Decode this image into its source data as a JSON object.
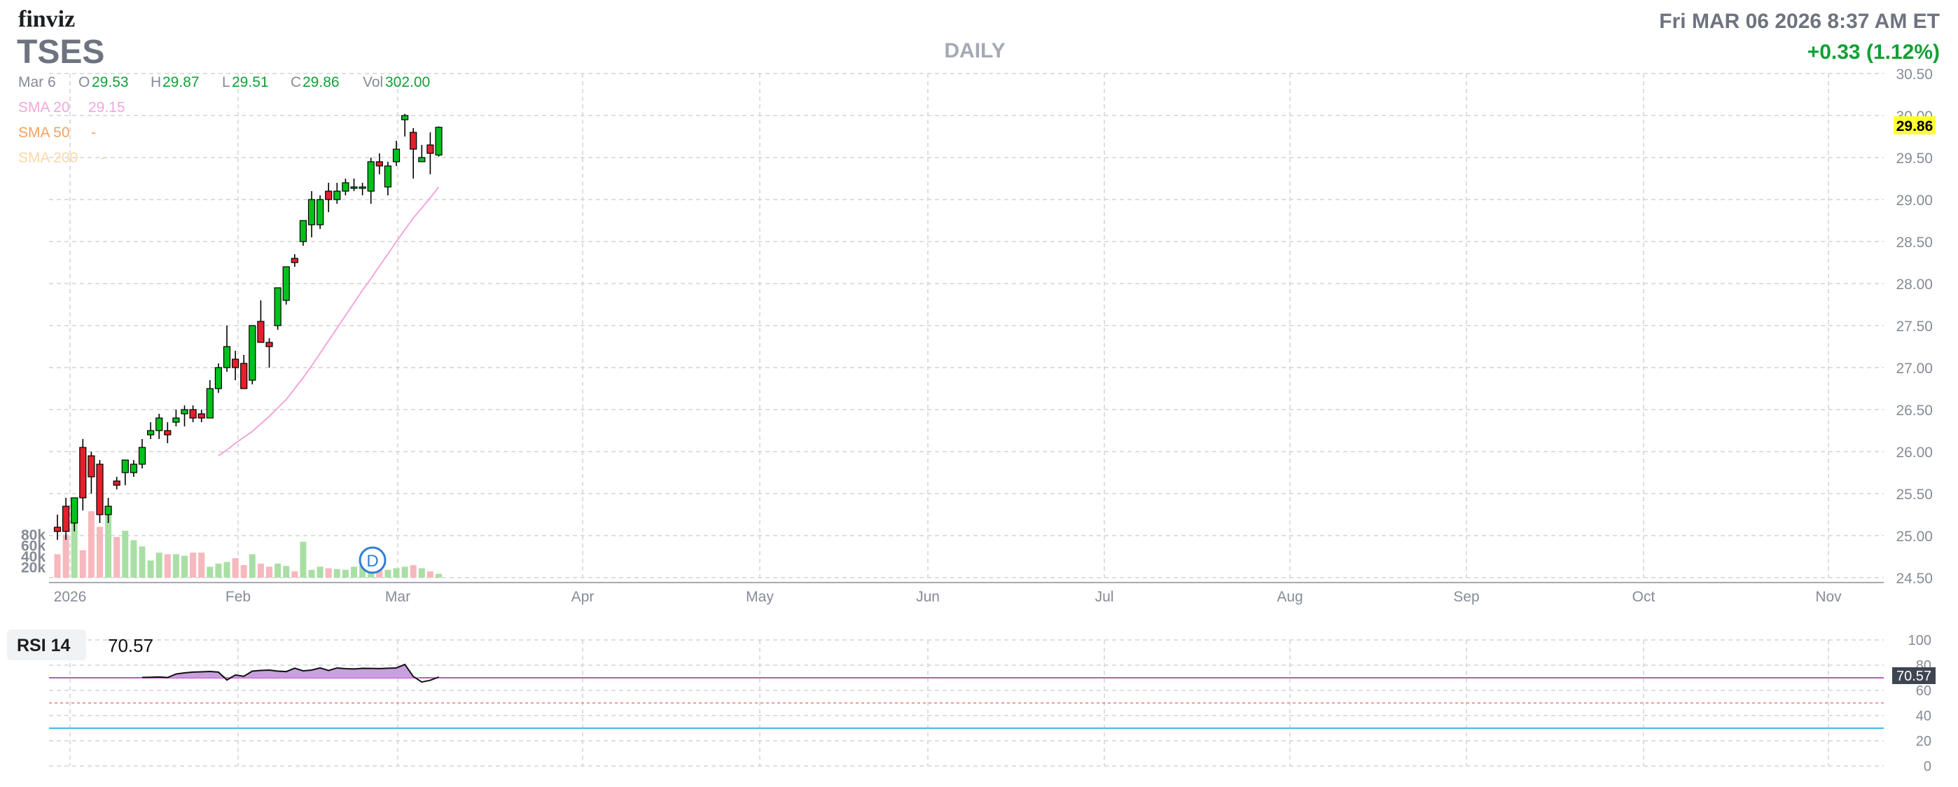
{
  "header": {
    "logo": "finviz",
    "ticker": "TSES",
    "timeframe": "DAILY",
    "datetime": "Fri MAR 06 2026 8:37 AM ET",
    "change": "+0.33 (1.12%)"
  },
  "quote": {
    "date": "Mar 6",
    "o_label": "O",
    "o": "29.53",
    "h_label": "H",
    "h": "29.87",
    "l_label": "L",
    "l": "29.51",
    "c_label": "C",
    "c": "29.86",
    "vol_label": "Vol",
    "vol": "302.00"
  },
  "sma": [
    {
      "label": "SMA 20",
      "value": "29.15",
      "color": "#f3a6dc"
    },
    {
      "label": "SMA 50",
      "value": "-",
      "color": "#f5a25d"
    },
    {
      "label": "SMA 200",
      "value": "-",
      "color": "#fbd9a5"
    }
  ],
  "rsi": {
    "label": "RSI 14",
    "value": "70.57",
    "badge": "70.57",
    "ylim": [
      0,
      100
    ],
    "overbought": 70,
    "oversold": 30,
    "midline": 50,
    "ticks": [
      "100",
      "80",
      "60",
      "40",
      "20",
      "0"
    ]
  },
  "last_price_badge": "29.86",
  "dividend_marker": "D",
  "colors": {
    "up": "#00c21c",
    "down": "#e3202c",
    "vol_up": "#a9dfa4",
    "vol_down": "#f7b7bd",
    "sma20": "#f3a6dc",
    "rsi_line": "#b259c8",
    "oversold_line": "#46b8e0",
    "price_badge": "#ffff33",
    "green_text": "#11a035",
    "grey_text": "#868b96"
  },
  "chart_data": {
    "type": "candlestick",
    "title": "TSES",
    "ylim": [
      24.5,
      30.5
    ],
    "yticks": [
      "30.50",
      "30.00",
      "29.50",
      "29.00",
      "28.50",
      "28.00",
      "27.50",
      "27.00",
      "26.50",
      "26.00",
      "25.50",
      "25.00",
      "24.50"
    ],
    "xticks": [
      "2026",
      "Feb",
      "Mar",
      "Apr",
      "May",
      "Jun",
      "Jul",
      "Aug",
      "Sep",
      "Oct",
      "Nov"
    ],
    "volume_ticks": [
      "80k",
      "60k",
      "40k",
      "20k"
    ],
    "volume_ylim": [
      0,
      100000
    ],
    "candles": [
      {
        "o": 25.1,
        "h": 25.25,
        "l": 24.95,
        "c": 25.05
      },
      {
        "o": 25.35,
        "h": 25.45,
        "l": 24.95,
        "c": 25.05
      },
      {
        "o": 25.15,
        "h": 25.45,
        "l": 25.05,
        "c": 25.45
      },
      {
        "o": 26.05,
        "h": 26.15,
        "l": 25.3,
        "c": 25.45
      },
      {
        "o": 25.95,
        "h": 26.0,
        "l": 25.5,
        "c": 25.7
      },
      {
        "o": 25.85,
        "h": 25.9,
        "l": 25.15,
        "c": 25.25
      },
      {
        "o": 25.25,
        "h": 25.45,
        "l": 25.15,
        "c": 25.35
      },
      {
        "o": 25.65,
        "h": 25.7,
        "l": 25.55,
        "c": 25.6
      },
      {
        "o": 25.75,
        "h": 25.85,
        "l": 25.6,
        "c": 25.9
      },
      {
        "o": 25.75,
        "h": 25.9,
        "l": 25.7,
        "c": 25.85
      },
      {
        "o": 25.85,
        "h": 26.15,
        "l": 25.8,
        "c": 26.05
      },
      {
        "o": 26.2,
        "h": 26.35,
        "l": 26.15,
        "c": 26.25
      },
      {
        "o": 26.25,
        "h": 26.45,
        "l": 26.15,
        "c": 26.4
      },
      {
        "o": 26.25,
        "h": 26.35,
        "l": 26.1,
        "c": 26.2
      },
      {
        "o": 26.35,
        "h": 26.5,
        "l": 26.3,
        "c": 26.4
      },
      {
        "o": 26.45,
        "h": 26.55,
        "l": 26.3,
        "c": 26.5
      },
      {
        "o": 26.5,
        "h": 26.55,
        "l": 26.35,
        "c": 26.4
      },
      {
        "o": 26.45,
        "h": 26.5,
        "l": 26.35,
        "c": 26.4
      },
      {
        "o": 26.4,
        "h": 26.85,
        "l": 26.4,
        "c": 26.75
      },
      {
        "o": 26.75,
        "h": 27.05,
        "l": 26.7,
        "c": 27.0
      },
      {
        "o": 27.0,
        "h": 27.5,
        "l": 26.95,
        "c": 27.25
      },
      {
        "o": 27.1,
        "h": 27.2,
        "l": 26.85,
        "c": 27.0
      },
      {
        "o": 27.05,
        "h": 27.15,
        "l": 26.75,
        "c": 26.75
      },
      {
        "o": 26.85,
        "h": 27.5,
        "l": 26.8,
        "c": 27.5
      },
      {
        "o": 27.55,
        "h": 27.8,
        "l": 27.4,
        "c": 27.3
      },
      {
        "o": 27.3,
        "h": 27.35,
        "l": 27.0,
        "c": 27.25
      },
      {
        "o": 27.5,
        "h": 27.95,
        "l": 27.45,
        "c": 27.95
      },
      {
        "o": 27.8,
        "h": 28.2,
        "l": 27.75,
        "c": 28.2
      },
      {
        "o": 28.3,
        "h": 28.35,
        "l": 28.2,
        "c": 28.25
      },
      {
        "o": 28.5,
        "h": 28.7,
        "l": 28.45,
        "c": 28.75
      },
      {
        "o": 28.7,
        "h": 29.1,
        "l": 28.55,
        "c": 29.0
      },
      {
        "o": 28.7,
        "h": 29.05,
        "l": 28.65,
        "c": 29.0
      },
      {
        "o": 29.1,
        "h": 29.2,
        "l": 28.85,
        "c": 29.0
      },
      {
        "o": 29.0,
        "h": 29.2,
        "l": 28.95,
        "c": 29.1
      },
      {
        "o": 29.1,
        "h": 29.25,
        "l": 29.05,
        "c": 29.2
      },
      {
        "o": 29.15,
        "h": 29.25,
        "l": 29.1,
        "c": 29.15
      },
      {
        "o": 29.15,
        "h": 29.2,
        "l": 29.05,
        "c": 29.15
      },
      {
        "o": 29.1,
        "h": 29.5,
        "l": 28.95,
        "c": 29.45
      },
      {
        "o": 29.45,
        "h": 29.55,
        "l": 29.3,
        "c": 29.4
      },
      {
        "o": 29.15,
        "h": 29.45,
        "l": 29.05,
        "c": 29.4
      },
      {
        "o": 29.45,
        "h": 29.7,
        "l": 29.4,
        "c": 29.6
      },
      {
        "o": 29.95,
        "h": 30.02,
        "l": 29.75,
        "c": 30.0
      },
      {
        "o": 29.8,
        "h": 29.85,
        "l": 29.25,
        "c": 29.6
      },
      {
        "o": 29.45,
        "h": 29.65,
        "l": 29.45,
        "c": 29.5
      },
      {
        "o": 29.65,
        "h": 29.8,
        "l": 29.3,
        "c": 29.55
      },
      {
        "o": 29.53,
        "h": 29.87,
        "l": 29.51,
        "c": 29.86
      }
    ],
    "volume": [
      30000,
      55000,
      72000,
      35000,
      85000,
      65000,
      90000,
      52000,
      60000,
      48000,
      40000,
      22000,
      32000,
      30000,
      30000,
      28000,
      32000,
      32000,
      14000,
      18000,
      20000,
      25000,
      16000,
      30000,
      18000,
      14000,
      18000,
      15000,
      8000,
      46000,
      10000,
      14000,
      12000,
      11000,
      10000,
      14000,
      16000,
      13000,
      10000,
      10000,
      12000,
      14000,
      16000,
      12000,
      8000,
      5000
    ],
    "sma20": [
      25.95,
      26.02,
      26.1,
      26.17,
      26.24,
      26.33,
      26.42,
      26.52,
      26.62,
      26.75,
      26.88,
      27.02,
      27.17,
      27.32,
      27.47,
      27.62,
      27.77,
      27.92,
      28.06,
      28.21,
      28.35,
      28.5,
      28.64,
      28.78,
      28.9,
      29.02,
      29.15
    ],
    "rsi": [
      70.3,
      70.4,
      70.6,
      70.2,
      73.0,
      73.9,
      74.5,
      74.7,
      75.0,
      74.5,
      68.2,
      72.2,
      71.2,
      75.3,
      75.8,
      76.1,
      75.3,
      74.9,
      77.6,
      75.5,
      76.1,
      77.8,
      75.8,
      77.8,
      77.2,
      77.0,
      77.5,
      77.4,
      77.3,
      77.6,
      77.8,
      80.6,
      71.0,
      66.6,
      68.0,
      70.6
    ]
  }
}
